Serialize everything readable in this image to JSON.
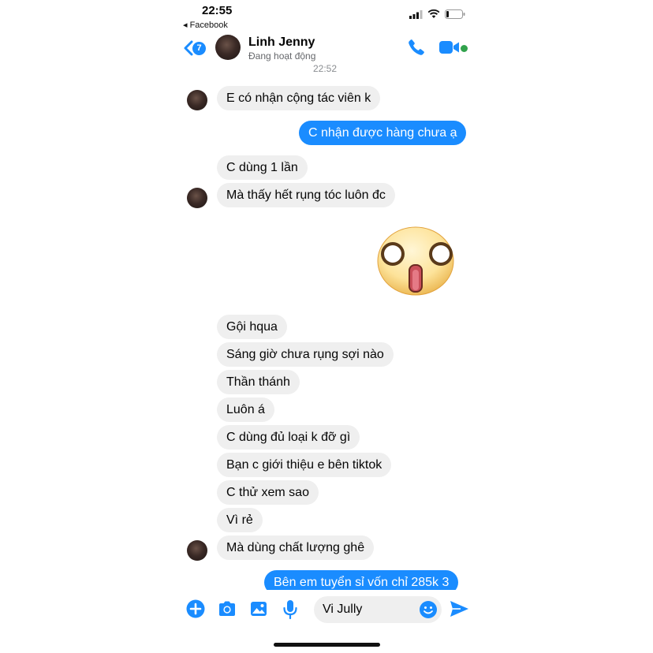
{
  "status_bar": {
    "time": "22:55",
    "back_app": "◂ Facebook"
  },
  "header": {
    "unread_badge": "7",
    "contact_name": "Linh Jenny",
    "contact_status": "Đang hoạt động",
    "time": "22:52"
  },
  "messages": [
    {
      "text": "E có nhận cộng tác viên k",
      "dir": "in"
    },
    {
      "text": "C nhận được hàng chưa ạ",
      "dir": "out"
    },
    {
      "text": "C dùng 1 lần",
      "dir": "in"
    },
    {
      "text": "Mà thấy hết rụng tóc luôn đc",
      "dir": "in"
    },
    {
      "text": "Gội hqua",
      "dir": "in"
    },
    {
      "text": "Sáng giờ chưa rụng sợi nào",
      "dir": "in"
    },
    {
      "text": "Thần thánh",
      "dir": "in"
    },
    {
      "text": "Luôn á",
      "dir": "in"
    },
    {
      "text": "C dùng đủ loại k đỡ gì",
      "dir": "in"
    },
    {
      "text": "Bạn c giới thiệu e bên tiktok",
      "dir": "in"
    },
    {
      "text": "C thử xem sao",
      "dir": "in"
    },
    {
      "text": "Vì rẻ",
      "dir": "in"
    },
    {
      "text": "Mà dùng chất lượng ghê",
      "dir": "in"
    },
    {
      "text": "Bên em tuyển sỉ vốn chỉ 285k 3",
      "dir": "out"
    }
  ],
  "composer": {
    "input_value": "Vi Jully"
  },
  "colors": {
    "accent": "#1a8cff",
    "incoming_bubble": "#efefef",
    "online": "#31a24c"
  }
}
